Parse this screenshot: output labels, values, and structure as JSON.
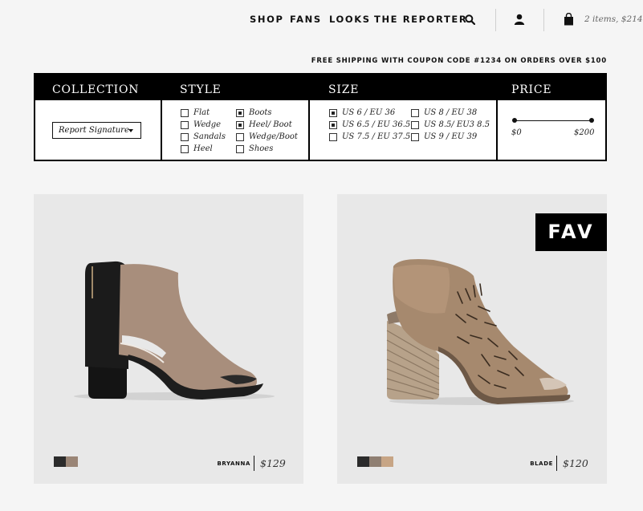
{
  "nav": {
    "items": [
      "SHOP",
      "FANS",
      "LOOKS",
      "THE REPORTER"
    ],
    "search_icon": "search-icon",
    "account_icon": "user-icon",
    "cart_icon": "shopping-bag-icon",
    "cart_summary": "2 items, $214"
  },
  "promo": "FREE SHIPPING WITH COUPON CODE #1234 ON ORDERS OVER $100",
  "filters": {
    "collection": {
      "title": "COLLECTION",
      "selected": "Report Signature"
    },
    "style": {
      "title": "STYLE",
      "options": [
        {
          "label": "Flat",
          "checked": false
        },
        {
          "label": "Wedge",
          "checked": false
        },
        {
          "label": "Sandals",
          "checked": false
        },
        {
          "label": "Heel",
          "checked": false
        },
        {
          "label": "Boots",
          "checked": true
        },
        {
          "label": "Heel/ Boot",
          "checked": true
        },
        {
          "label": "Wedge/Boot",
          "checked": false
        },
        {
          "label": "Shoes",
          "checked": false
        }
      ]
    },
    "size": {
      "title": "SIZE",
      "options": [
        {
          "label": "US 6 / EU 36",
          "checked": true
        },
        {
          "label": "US 6.5 / EU 36.5",
          "checked": true
        },
        {
          "label": "US 7.5 / EU 37.5",
          "checked": false
        },
        {
          "label": "US 8 / EU 38",
          "checked": false
        },
        {
          "label": "US 8.5/ EU3 8.5",
          "checked": false
        },
        {
          "label": "US 9 / EU 39",
          "checked": false
        }
      ]
    },
    "price": {
      "title": "PRICE",
      "min_label": "$0",
      "max_label": "$200"
    }
  },
  "products": [
    {
      "name": "BRYANNA",
      "price": "$129",
      "favorite": false,
      "swatches": [
        "#2b2b2b",
        "#9a8576"
      ]
    },
    {
      "name": "BLADE",
      "price": "$120",
      "favorite": true,
      "fav_label": "FAV",
      "swatches": [
        "#2b2b2b",
        "#8f7f72",
        "#c7a585"
      ]
    }
  ],
  "colors": {
    "accent": "#000000",
    "card_bg": "#e8e8e8",
    "page_bg": "#f5f5f5"
  }
}
